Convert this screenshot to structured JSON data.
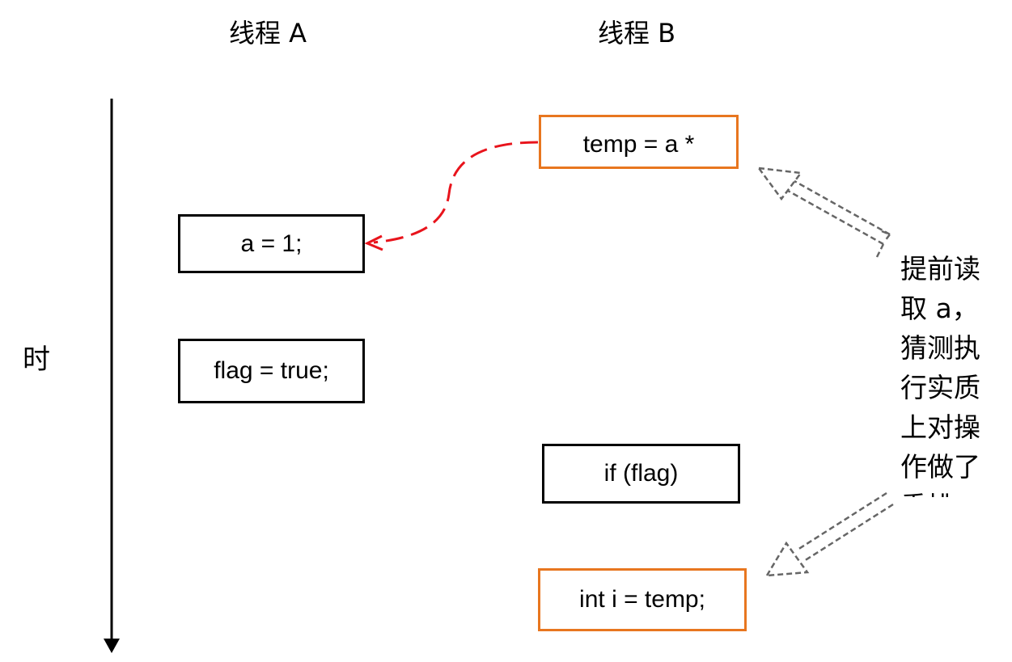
{
  "headers": {
    "thread_a": "线程 A",
    "thread_b": "线程 B"
  },
  "time_axis": {
    "label": "时"
  },
  "thread_a_ops": {
    "assign_a": "a = 1;",
    "assign_flag": "flag = true;"
  },
  "thread_b_ops": {
    "temp": "temp = a *",
    "if_flag": "if (flag)",
    "int_i": "int i = temp;"
  },
  "note": {
    "lines": [
      "提前读",
      "取 a，",
      "猜测执",
      "行实质",
      "上对操",
      "作做了",
      "重排"
    ]
  },
  "colors": {
    "orange": "#e8761f",
    "red_dashed": "#e8141c",
    "gray_arrow": "#666666"
  }
}
